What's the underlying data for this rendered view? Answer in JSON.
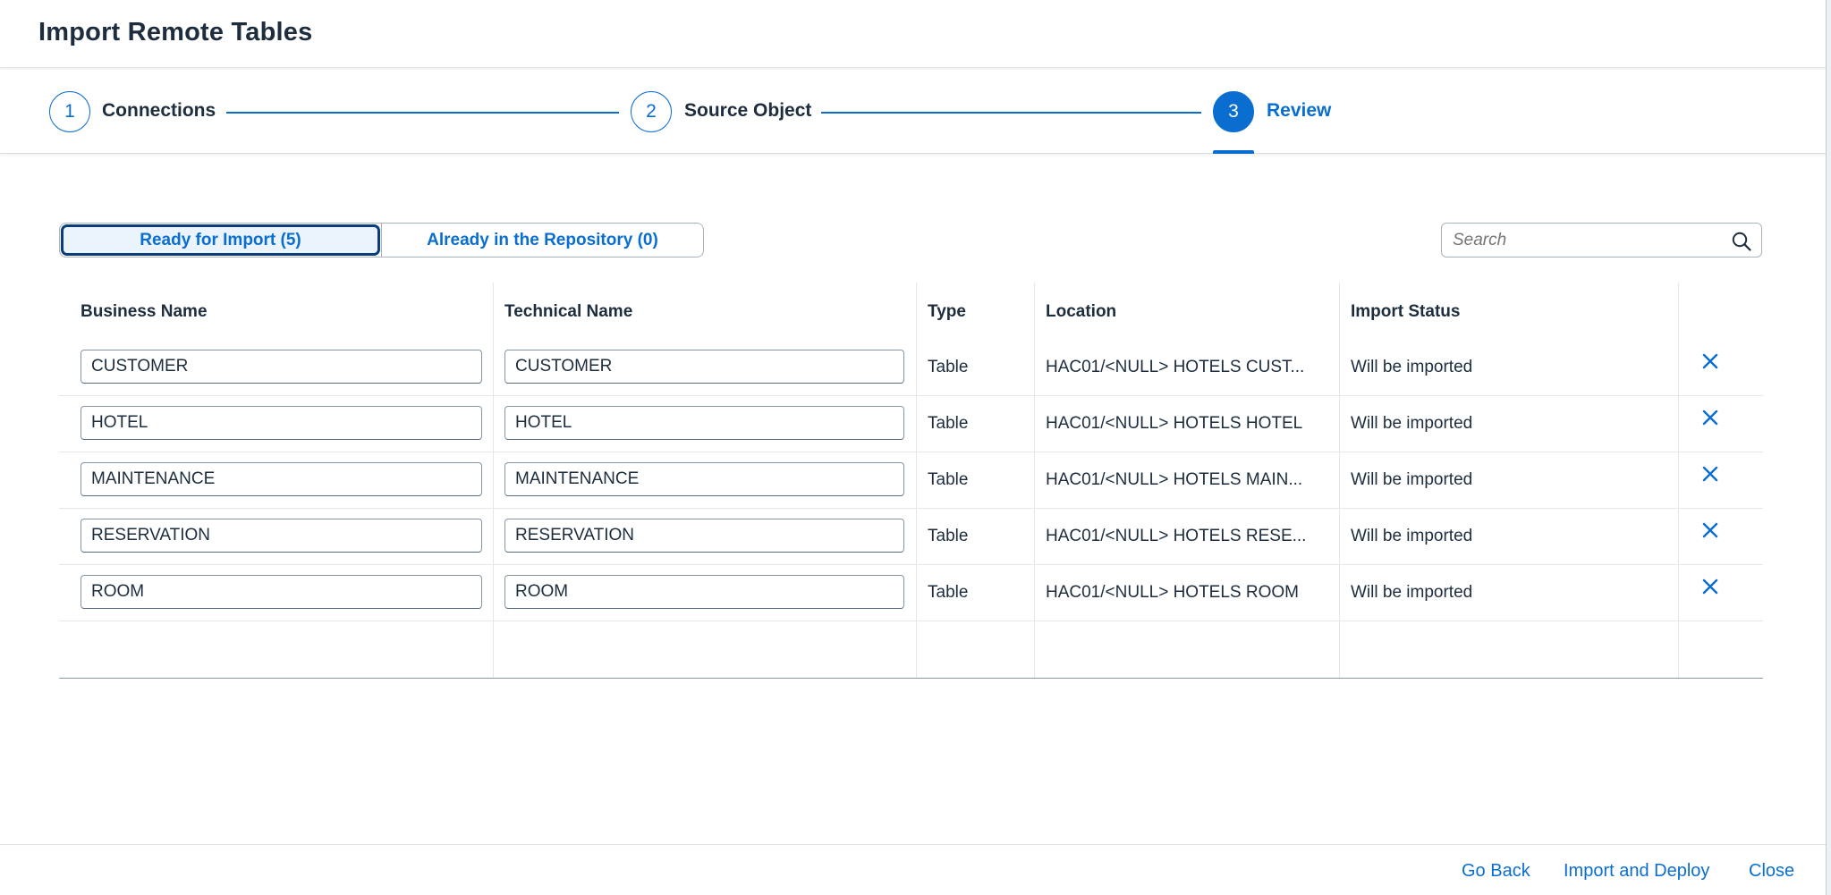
{
  "dialog": {
    "title": "Import Remote Tables"
  },
  "wizard": {
    "steps": [
      {
        "number": "1",
        "label": "Connections"
      },
      {
        "number": "2",
        "label": "Source Object"
      },
      {
        "number": "3",
        "label": "Review"
      }
    ],
    "active_step": 3
  },
  "segments": {
    "ready": "Ready for Import (5)",
    "repository": "Already in the Repository (0)"
  },
  "search": {
    "placeholder": "Search"
  },
  "table": {
    "headers": {
      "business_name": "Business Name",
      "technical_name": "Technical Name",
      "type": "Type",
      "location": "Location",
      "import_status": "Import Status"
    },
    "rows": [
      {
        "business_name": "CUSTOMER",
        "technical_name": "CUSTOMER",
        "type": "Table",
        "location": "HAC01/<NULL> HOTELS CUST...",
        "import_status": "Will be imported"
      },
      {
        "business_name": "HOTEL",
        "technical_name": "HOTEL",
        "type": "Table",
        "location": "HAC01/<NULL> HOTELS HOTEL",
        "import_status": "Will be imported"
      },
      {
        "business_name": "MAINTENANCE",
        "technical_name": "MAINTENANCE",
        "type": "Table",
        "location": "HAC01/<NULL> HOTELS MAIN...",
        "import_status": "Will be imported"
      },
      {
        "business_name": "RESERVATION",
        "technical_name": "RESERVATION",
        "type": "Table",
        "location": "HAC01/<NULL> HOTELS RESE...",
        "import_status": "Will be imported"
      },
      {
        "business_name": "ROOM",
        "technical_name": "ROOM",
        "type": "Table",
        "location": "HAC01/<NULL> HOTELS ROOM",
        "import_status": "Will be imported"
      }
    ]
  },
  "footer": {
    "go_back": "Go Back",
    "import_deploy": "Import and Deploy",
    "close": "Close"
  },
  "icons": {
    "search": "search-icon",
    "delete": "close-icon"
  },
  "colors": {
    "accent": "#0a6ed1",
    "text": "#1d2d3e",
    "selected_segment_bg": "#ebf4fd"
  }
}
